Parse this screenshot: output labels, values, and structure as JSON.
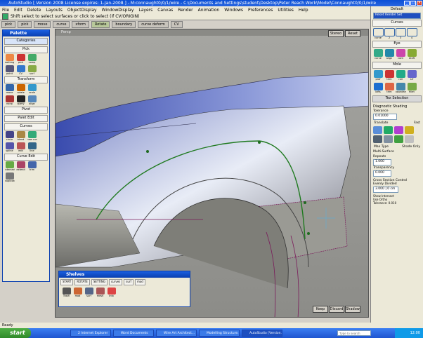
{
  "window": {
    "title": "AutoStudio [ Version 2008 License expires: 1-Jan-2008 ] - M:connaught0/0/1/wire - C:\\Documents and Settings\\student\\Desktop\\Peter Reach Work\\Model\\Connaught0/0/1/wire"
  },
  "menu": [
    "File",
    "Edit",
    "Delete",
    "Layouts",
    "ObjectDisplay",
    "WindowDisplay",
    "Layers",
    "Canvas",
    "Render",
    "Animation",
    "Windows",
    "Preferences",
    "Utilities",
    "Help"
  ],
  "prompt": "Shift select to select surfaces or click to select (if CV/ORIGIN)",
  "toolstrip": [
    {
      "label": "pick",
      "on": false
    },
    {
      "label": "pick",
      "on": false
    },
    {
      "label": "move",
      "on": false
    },
    {
      "label": "curve",
      "on": false
    },
    {
      "label": "xform",
      "on": false
    },
    {
      "label": "Rotate",
      "on": true
    },
    {
      "label": "boundary",
      "on": false
    },
    {
      "label": "curve deform",
      "on": false
    },
    {
      "label": "CV",
      "on": false
    }
  ],
  "viewport": {
    "label": "Persp",
    "buttons": [
      "Stereo",
      "Reset"
    ],
    "bottom_buttons": [
      "Keep",
      "Discard",
      "Shadow"
    ]
  },
  "palette": {
    "title": "Palette",
    "category_label": "Categories",
    "sections": [
      {
        "name": "Pick",
        "tools": [
          "nothing",
          "pick",
          "pick",
          "comp",
          "object",
          "comp",
          "curvature",
          "point",
          "CV",
          "surf",
          "reset",
          "bound"
        ]
      },
      {
        "name": "Transform",
        "tools": [
          "move",
          "rotate",
          "scale",
          "nonp",
          "mov sh",
          "copy",
          "align",
          "stamp",
          "query",
          "shap",
          "scale",
          "rev"
        ]
      },
      {
        "name": "Pivot",
        "tools": []
      },
      {
        "name": "Palet Edit",
        "tools": []
      },
      {
        "name": "Curves",
        "tools": [
          "circle",
          "circle",
          "blend",
          "new curve",
          "crv",
          "spline",
          "edit",
          "line",
          "line"
        ]
      },
      {
        "name": "Curve Edit",
        "tools": [
          "edit",
          "pick",
          "intersect",
          "extend",
          "blend",
          "trim",
          "cut",
          "duplicate",
          "insert"
        ]
      }
    ]
  },
  "right_panel": {
    "header": "Default",
    "header_sub": "Reset Rendel Set",
    "curves_section": "Curves",
    "curve_tools": [
      "curve",
      "2",
      "3",
      "4",
      "circle"
    ],
    "eye_section": "Eye",
    "eye_tools": [
      "curve",
      "align",
      "cont",
      "draft"
    ],
    "surface_section": "Mole",
    "surface_tools": [
      "prof",
      "trim",
      "rail",
      "srf",
      "lofts",
      "trim",
      "boundary",
      "fillet",
      "skin",
      "trim"
    ],
    "mode_section": "Tex Selection",
    "display_title": "Diagnostic Shading",
    "tolerance_label": "Tolerance",
    "tolerance_value": "0.01000",
    "translate_label": "Translate",
    "fast_label": "Fast",
    "preset_label": "Preset",
    "max_type_label": "Max Type",
    "max_type_value": "Shade Only",
    "multi_surface": "Multi-Surface",
    "repeats_label": "Repeats",
    "repeats_value": "1.000",
    "transparency_label": "Transparency",
    "transparency_value": "0.000",
    "cross_section_label": "Cross Section Control",
    "cross_section_sub": "Evenly Divided",
    "number_value": "3.000 | 0 cm",
    "bottom_labels": [
      "Show Intersect",
      "Use Ortho",
      "Tolerance: 0.010"
    ]
  },
  "shelves": {
    "title": "Shelves",
    "tabs": [
      "START",
      "ROTATE",
      "SETTING",
      "curves",
      "surf",
      "mod"
    ],
    "tools": [
      "Trash",
      "mod",
      "surf",
      "mesh",
      "Info"
    ]
  },
  "statusbar": "Ready",
  "taskbar": {
    "start": "start",
    "tasks": [
      "2 Internet Explorer",
      "Word Documents",
      "Wire Art Architect...",
      "Modelling Structure...",
      "AutoStudio [Version..."
    ],
    "search_placeholder": "Type to search",
    "time": "12:00"
  },
  "colors": {
    "title": "#0a4fd6",
    "car_body": "#b8c0e0",
    "curve": "#2f8a2a"
  }
}
